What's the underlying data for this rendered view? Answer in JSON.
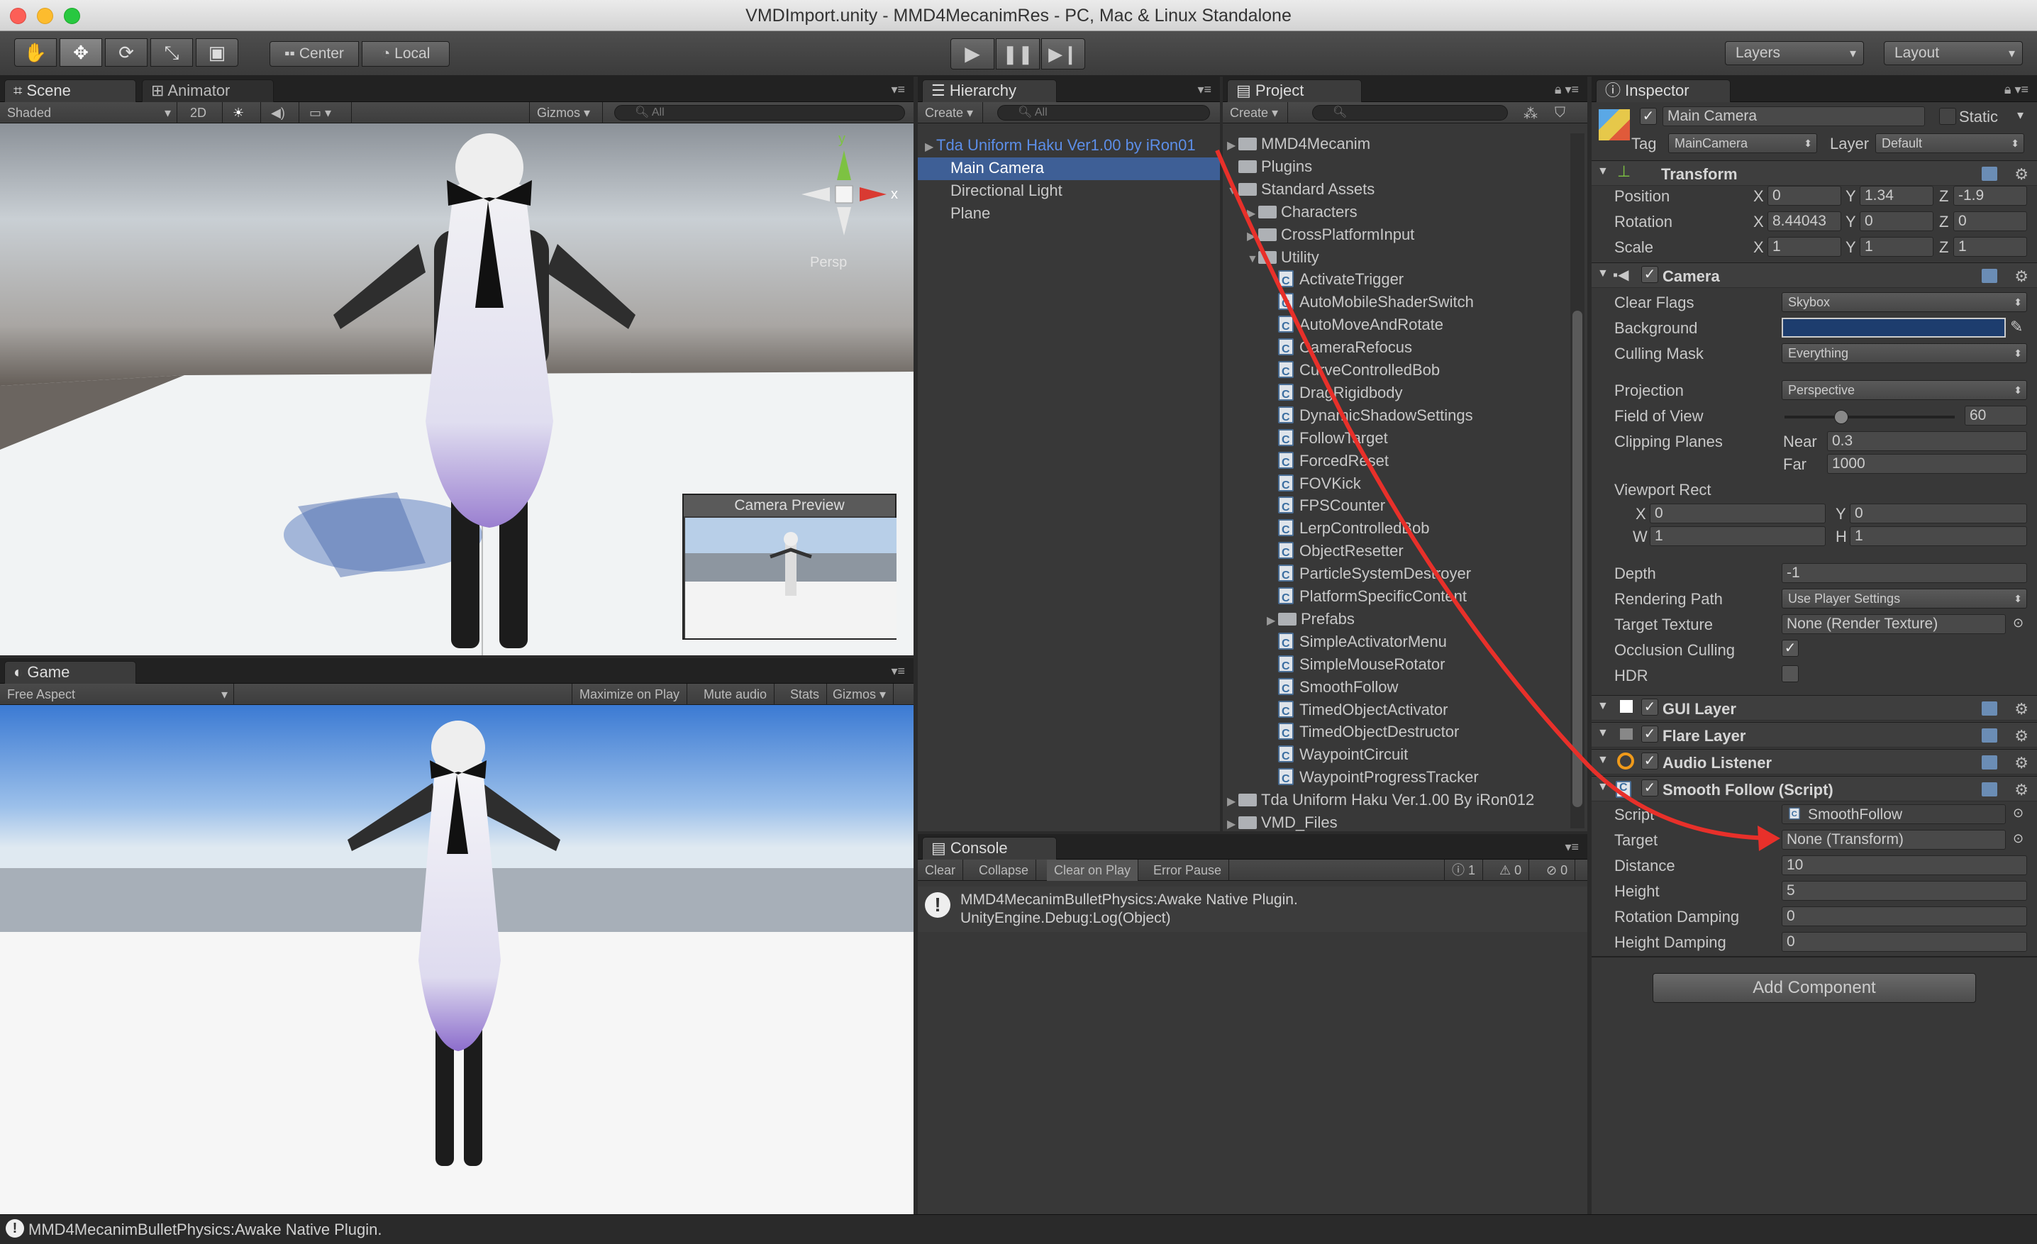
{
  "window": {
    "title": "VMDImport.unity - MMD4MecanimRes - PC, Mac & Linux Standalone"
  },
  "toolbar": {
    "pivot": "Center",
    "space": "Local",
    "layers": "Layers",
    "layout": "Layout",
    "tools": [
      "hand-icon",
      "move-icon",
      "rotate-icon",
      "scale-icon",
      "rect-icon"
    ]
  },
  "scene": {
    "tab": "Scene",
    "tab2": "Animator",
    "shading": "Shaded",
    "mode2d": "2D",
    "gizmos": "Gizmos",
    "search": "All",
    "persp": "Persp",
    "gizmo_y": "y",
    "gizmo_x": "x",
    "camera_preview": "Camera Preview"
  },
  "game": {
    "tab": "Game",
    "aspect": "Free Aspect",
    "maximize": "Maximize on Play",
    "mute": "Mute audio",
    "stats": "Stats",
    "gizmos": "Gizmos"
  },
  "hierarchy": {
    "tab": "Hierarchy",
    "create": "Create",
    "search": "All",
    "items": [
      {
        "label": "Tda Uniform Haku Ver1.00 by iRon01",
        "indent": 0,
        "arrow": "▶",
        "style": "prefab"
      },
      {
        "label": "Main Camera",
        "indent": 1,
        "arrow": "",
        "style": "selected"
      },
      {
        "label": "Directional Light",
        "indent": 1,
        "arrow": "",
        "style": "normal"
      },
      {
        "label": "Plane",
        "indent": 1,
        "arrow": "",
        "style": "normal"
      }
    ]
  },
  "project": {
    "tab": "Project",
    "create": "Create",
    "items": [
      {
        "label": "MMD4Mecanim",
        "indent": 0,
        "arrow": "▶",
        "type": "folder"
      },
      {
        "label": "Plugins",
        "indent": 0,
        "arrow": "",
        "type": "folder"
      },
      {
        "label": "Standard Assets",
        "indent": 0,
        "arrow": "▼",
        "type": "folder"
      },
      {
        "label": "Characters",
        "indent": 1,
        "arrow": "▶",
        "type": "folder"
      },
      {
        "label": "CrossPlatformInput",
        "indent": 1,
        "arrow": "▶",
        "type": "folder"
      },
      {
        "label": "Utility",
        "indent": 1,
        "arrow": "▼",
        "type": "folder"
      },
      {
        "label": "ActivateTrigger",
        "indent": 2,
        "arrow": "",
        "type": "script"
      },
      {
        "label": "AutoMobileShaderSwitch",
        "indent": 2,
        "arrow": "",
        "type": "script"
      },
      {
        "label": "AutoMoveAndRotate",
        "indent": 2,
        "arrow": "",
        "type": "script"
      },
      {
        "label": "CameraRefocus",
        "indent": 2,
        "arrow": "",
        "type": "script"
      },
      {
        "label": "CurveControlledBob",
        "indent": 2,
        "arrow": "",
        "type": "script"
      },
      {
        "label": "DragRigidbody",
        "indent": 2,
        "arrow": "",
        "type": "script"
      },
      {
        "label": "DynamicShadowSettings",
        "indent": 2,
        "arrow": "",
        "type": "script"
      },
      {
        "label": "FollowTarget",
        "indent": 2,
        "arrow": "",
        "type": "script"
      },
      {
        "label": "ForcedReset",
        "indent": 2,
        "arrow": "",
        "type": "script"
      },
      {
        "label": "FOVKick",
        "indent": 2,
        "arrow": "",
        "type": "script"
      },
      {
        "label": "FPSCounter",
        "indent": 2,
        "arrow": "",
        "type": "script"
      },
      {
        "label": "LerpControlledBob",
        "indent": 2,
        "arrow": "",
        "type": "script"
      },
      {
        "label": "ObjectResetter",
        "indent": 2,
        "arrow": "",
        "type": "script"
      },
      {
        "label": "ParticleSystemDestroyer",
        "indent": 2,
        "arrow": "",
        "type": "script"
      },
      {
        "label": "PlatformSpecificContent",
        "indent": 2,
        "arrow": "",
        "type": "script"
      },
      {
        "label": "Prefabs",
        "indent": 2,
        "arrow": "▶",
        "type": "folder"
      },
      {
        "label": "SimpleActivatorMenu",
        "indent": 2,
        "arrow": "",
        "type": "script"
      },
      {
        "label": "SimpleMouseRotator",
        "indent": 2,
        "arrow": "",
        "type": "script"
      },
      {
        "label": "SmoothFollow",
        "indent": 2,
        "arrow": "",
        "type": "script"
      },
      {
        "label": "TimedObjectActivator",
        "indent": 2,
        "arrow": "",
        "type": "script"
      },
      {
        "label": "TimedObjectDestructor",
        "indent": 2,
        "arrow": "",
        "type": "script"
      },
      {
        "label": "WaypointCircuit",
        "indent": 2,
        "arrow": "",
        "type": "script"
      },
      {
        "label": "WaypointProgressTracker",
        "indent": 2,
        "arrow": "",
        "type": "script"
      },
      {
        "label": "Tda Uniform Haku Ver.1.00 By iRon012",
        "indent": 0,
        "arrow": "▶",
        "type": "folder"
      },
      {
        "label": "VMD_Files",
        "indent": 0,
        "arrow": "▶",
        "type": "folder"
      }
    ]
  },
  "console": {
    "tab": "Console",
    "buttons": [
      "Clear",
      "Collapse",
      "Clear on Play",
      "Error Pause"
    ],
    "counts": {
      "info": "1",
      "warn": "0",
      "error": "0"
    },
    "message_line1": "MMD4MecanimBulletPhysics:Awake Native Plugin.",
    "message_line2": "UnityEngine.Debug:Log(Object)"
  },
  "status_bar": {
    "message": "MMD4MecanimBulletPhysics:Awake Native Plugin."
  },
  "inspector": {
    "tab": "Inspector",
    "object_name": "Main Camera",
    "static_label": "Static",
    "tag_label": "Tag",
    "tag_value": "MainCamera",
    "layer_label": "Layer",
    "layer_value": "Default",
    "transform": {
      "title": "Transform",
      "position_label": "Position",
      "pos_x": "0",
      "pos_y": "1.34",
      "pos_z": "-1.9",
      "rotation_label": "Rotation",
      "rot_x": "8.44043",
      "rot_y": "0",
      "rot_z": "0",
      "scale_label": "Scale",
      "scl_x": "1",
      "scl_y": "1",
      "scl_z": "1"
    },
    "camera": {
      "title": "Camera",
      "clear_flags_label": "Clear Flags",
      "clear_flags": "Skybox",
      "background_label": "Background",
      "background_color": "#1d3d6e",
      "culling_mask_label": "Culling Mask",
      "culling_mask": "Everything",
      "projection_label": "Projection",
      "projection": "Perspective",
      "fov_label": "Field of View",
      "fov": "60",
      "clipping_label": "Clipping Planes",
      "near_label": "Near",
      "near": "0.3",
      "far_label": "Far",
      "far": "1000",
      "viewport_label": "Viewport Rect",
      "vx": "0",
      "vy": "0",
      "vw": "1",
      "vh": "1",
      "depth_label": "Depth",
      "depth": "-1",
      "rendering_path_label": "Rendering Path",
      "rendering_path": "Use Player Settings",
      "target_texture_label": "Target Texture",
      "target_texture": "None (Render Texture)",
      "occlusion_label": "Occlusion Culling",
      "hdr_label": "HDR"
    },
    "components": [
      "GUI Layer",
      "Flare Layer",
      "Audio Listener",
      "Smooth Follow (Script)"
    ],
    "smooth_follow": {
      "script_label": "Script",
      "script": "SmoothFollow",
      "target_label": "Target",
      "target": "None (Transform)",
      "distance_label": "Distance",
      "distance": "10",
      "height_label": "Height",
      "height": "5",
      "rot_damp_label": "Rotation Damping",
      "rot_damp": "0",
      "height_damp_label": "Height Damping",
      "height_damp": "0"
    },
    "add_component": "Add Component"
  }
}
